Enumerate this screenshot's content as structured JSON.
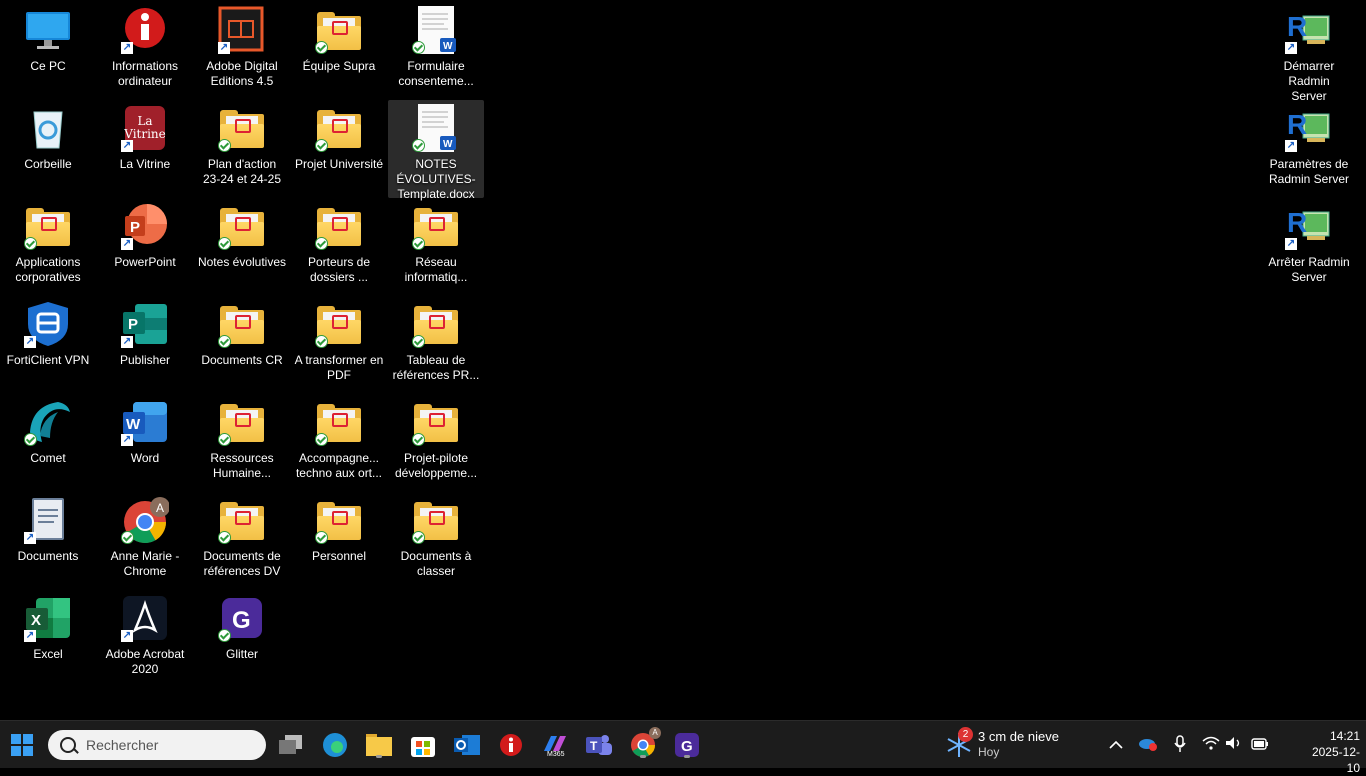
{
  "desktop": {
    "icons": [
      {
        "label": "Ce PC",
        "icon": "computer-icon",
        "type": "monitor"
      },
      {
        "label": "Informations\nordinateur",
        "icon": "info-icon",
        "type": "info"
      },
      {
        "label": "Adobe Digital\nEditions 4.5",
        "icon": "adobe-digital-editions-icon",
        "type": "ade"
      },
      {
        "label": "Équipe Supra",
        "icon": "folder-icon",
        "type": "folder"
      },
      {
        "label": "Formulaire\nconsenteme...",
        "icon": "word-document-icon",
        "type": "doc"
      },
      {
        "label": "Corbeille",
        "icon": "recycle-bin-icon",
        "type": "bin"
      },
      {
        "label": "La Vitrine",
        "icon": "la-vitrine-icon",
        "type": "vitrine",
        "tile_text": "La\nVitrine"
      },
      {
        "label": "Plan d'action\n23-24 et 24-25",
        "icon": "folder-icon",
        "type": "folder"
      },
      {
        "label": "Projet Université",
        "icon": "folder-icon",
        "type": "folder"
      },
      {
        "label": "NOTES\nÉVOLUTIVES-\nTemplate.docx",
        "icon": "word-document-icon",
        "type": "doc",
        "selected": true
      },
      {
        "label": "Applications\ncorporatives",
        "icon": "folder-icon",
        "type": "folder"
      },
      {
        "label": "PowerPoint",
        "icon": "powerpoint-icon",
        "type": "ppt",
        "tile_text": "P"
      },
      {
        "label": "Notes évolutives",
        "icon": "folder-icon",
        "type": "folder"
      },
      {
        "label": "Porteurs de\ndossiers ...",
        "icon": "folder-icon",
        "type": "folder"
      },
      {
        "label": "Réseau\ninformatiq...",
        "icon": "folder-icon",
        "type": "folder"
      },
      {
        "label": "FortiClient VPN",
        "icon": "forticlient-icon",
        "type": "forti"
      },
      {
        "label": "Publisher",
        "icon": "publisher-icon",
        "type": "pub",
        "tile_text": "P"
      },
      {
        "label": "Documents CR",
        "icon": "folder-icon",
        "type": "folder"
      },
      {
        "label": "A transformer en\nPDF",
        "icon": "folder-icon",
        "type": "folder"
      },
      {
        "label": "Tableau de\nréférences PR...",
        "icon": "folder-icon",
        "type": "folder"
      },
      {
        "label": "Comet",
        "icon": "comet-icon",
        "type": "comet"
      },
      {
        "label": "Word",
        "icon": "word-icon",
        "type": "word",
        "tile_text": "W"
      },
      {
        "label": "Ressources\nHumaine...",
        "icon": "folder-icon",
        "type": "folder"
      },
      {
        "label": "Accompagne...\ntechno aux ort...",
        "icon": "folder-icon",
        "type": "folder"
      },
      {
        "label": "Projet-pilote\ndéveloppeme...",
        "icon": "folder-icon",
        "type": "folder"
      },
      {
        "label": "Documents",
        "icon": "documents-icon",
        "type": "docs"
      },
      {
        "label": "Anne Marie -\nChrome",
        "icon": "chrome-icon",
        "type": "chrome",
        "tile_text": "A"
      },
      {
        "label": "Documents de\nréférences DV",
        "icon": "folder-icon",
        "type": "folder"
      },
      {
        "label": "Personnel",
        "icon": "folder-icon",
        "type": "folder"
      },
      {
        "label": "Documents à\nclasser",
        "icon": "folder-icon",
        "type": "folder"
      },
      {
        "label": "Excel",
        "icon": "excel-icon",
        "type": "excel",
        "tile_text": "X"
      },
      {
        "label": "Adobe Acrobat\n2020",
        "icon": "acrobat-icon",
        "type": "acrobat",
        "tile_text": "A"
      },
      {
        "label": "Glitter",
        "icon": "glitter-icon",
        "type": "glitter",
        "tile_text": "G"
      },
      {
        "label": "Démarrer Radmin\nServer",
        "icon": "radmin-icon",
        "type": "radmin",
        "tile_text": "R"
      },
      {
        "label": "Paramètres de\nRadmin Server",
        "icon": "radmin-icon",
        "type": "radmin",
        "tile_text": "R"
      },
      {
        "label": "Arrêter Radmin\nServer",
        "icon": "radmin-icon",
        "type": "radmin",
        "tile_text": "R"
      }
    ]
  },
  "taskbar": {
    "search_placeholder": "Rechercher",
    "chrome_badge": "A",
    "weather": {
      "badge": "2",
      "line1": "3 cm de nieve",
      "line2": "Hoy"
    },
    "tray": {
      "chevron": "^",
      "mic": "🎙",
      "wifi": "◠",
      "volume": "🔊",
      "battery": "▭"
    },
    "clock": {
      "time": "14:21",
      "date": "2025-12-10"
    },
    "apps": [
      {
        "name": "start-button",
        "icon": "windows-start-icon"
      },
      {
        "name": "task-view-button",
        "icon": "task-view-icon"
      },
      {
        "name": "edge-button",
        "icon": "edge-icon"
      },
      {
        "name": "file-explorer-button",
        "icon": "folder-icon"
      },
      {
        "name": "store-button",
        "icon": "store-icon"
      },
      {
        "name": "outlook-button",
        "icon": "outlook-icon"
      },
      {
        "name": "info-app-button",
        "icon": "info-icon"
      },
      {
        "name": "m365-button",
        "icon": "m365-icon"
      },
      {
        "name": "teams-button",
        "icon": "teams-icon"
      },
      {
        "name": "chrome-button",
        "icon": "chrome-icon"
      },
      {
        "name": "glitter-button",
        "icon": "glitter-icon"
      }
    ],
    "colors": {
      "background": "#1c1c1c",
      "accent": "#0078d4"
    }
  }
}
